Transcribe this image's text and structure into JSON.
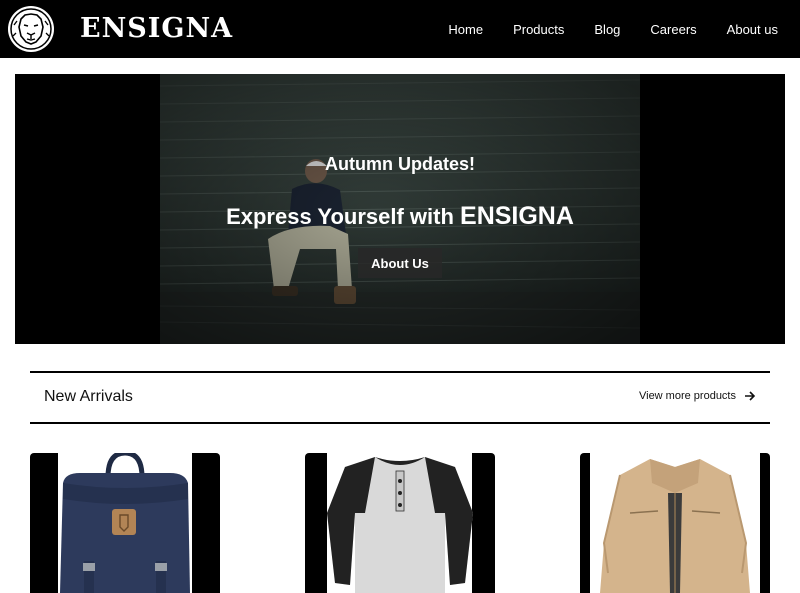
{
  "header": {
    "brand": "ENSIGNA",
    "logo_icon": "lion-head-icon",
    "nav": [
      {
        "label": "Home"
      },
      {
        "label": "Products"
      },
      {
        "label": "Blog"
      },
      {
        "label": "Careers"
      },
      {
        "label": "About us"
      }
    ]
  },
  "hero": {
    "subtitle": "Autumn Updates!",
    "title_prefix": "Express Yourself with ",
    "title_brand": "ENSIGNA",
    "button_label": "About Us"
  },
  "arrivals": {
    "title": "New Arrivals",
    "view_more_label": "View more products",
    "view_more_icon": "arrow-right-icon"
  },
  "products": [
    {
      "image": "navy-backpack"
    },
    {
      "image": "raglan-henley-shirt"
    },
    {
      "image": "khaki-jacket"
    }
  ],
  "colors": {
    "header_bg": "#000000",
    "page_bg": "#ffffff",
    "button_bg": "#2a2a2a"
  }
}
